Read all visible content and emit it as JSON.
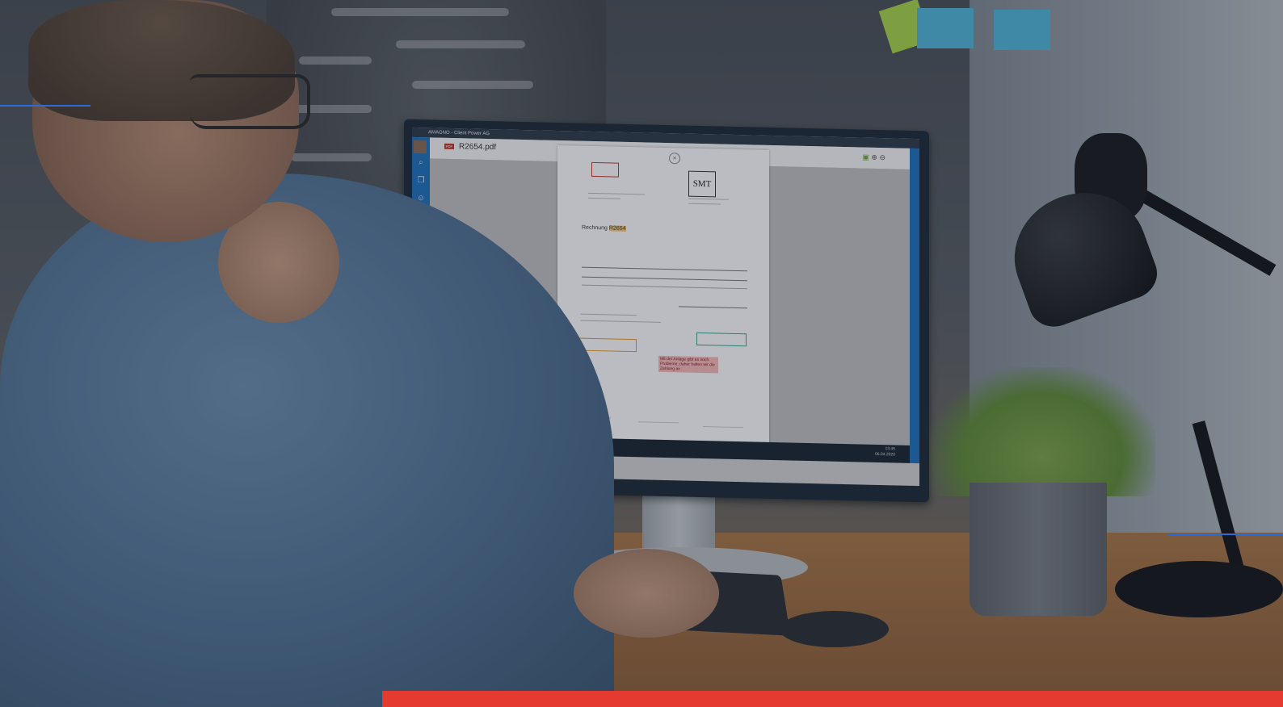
{
  "window": {
    "title": "AMAGNO - Client Power AG"
  },
  "viewer": {
    "file_name": "R2654.pdf",
    "pdf_badge": "PDF",
    "close_glyph": "×",
    "tool_icons": [
      "document-icon",
      "zoom-in-icon",
      "zoom-out-icon"
    ],
    "sidebar_icons": [
      "search-icon",
      "copy-icon",
      "user-icon",
      "comment-icon",
      "inbox-icon"
    ]
  },
  "invoice": {
    "logo_text": "SMT",
    "heading_prefix": "Rechnung",
    "heading_number": "R2654",
    "note_text": "Mit der Anlage gibt es noch Probleme, daher halten wir die Zahlung an"
  },
  "taskbar": {
    "time": "13:45",
    "date": "06.04.2020"
  },
  "colors": {
    "accent_red": "#e53a2f",
    "accent_blue": "#2a6bd6",
    "app_blue": "#1f6fb8",
    "highlight": "#f3c87a"
  }
}
